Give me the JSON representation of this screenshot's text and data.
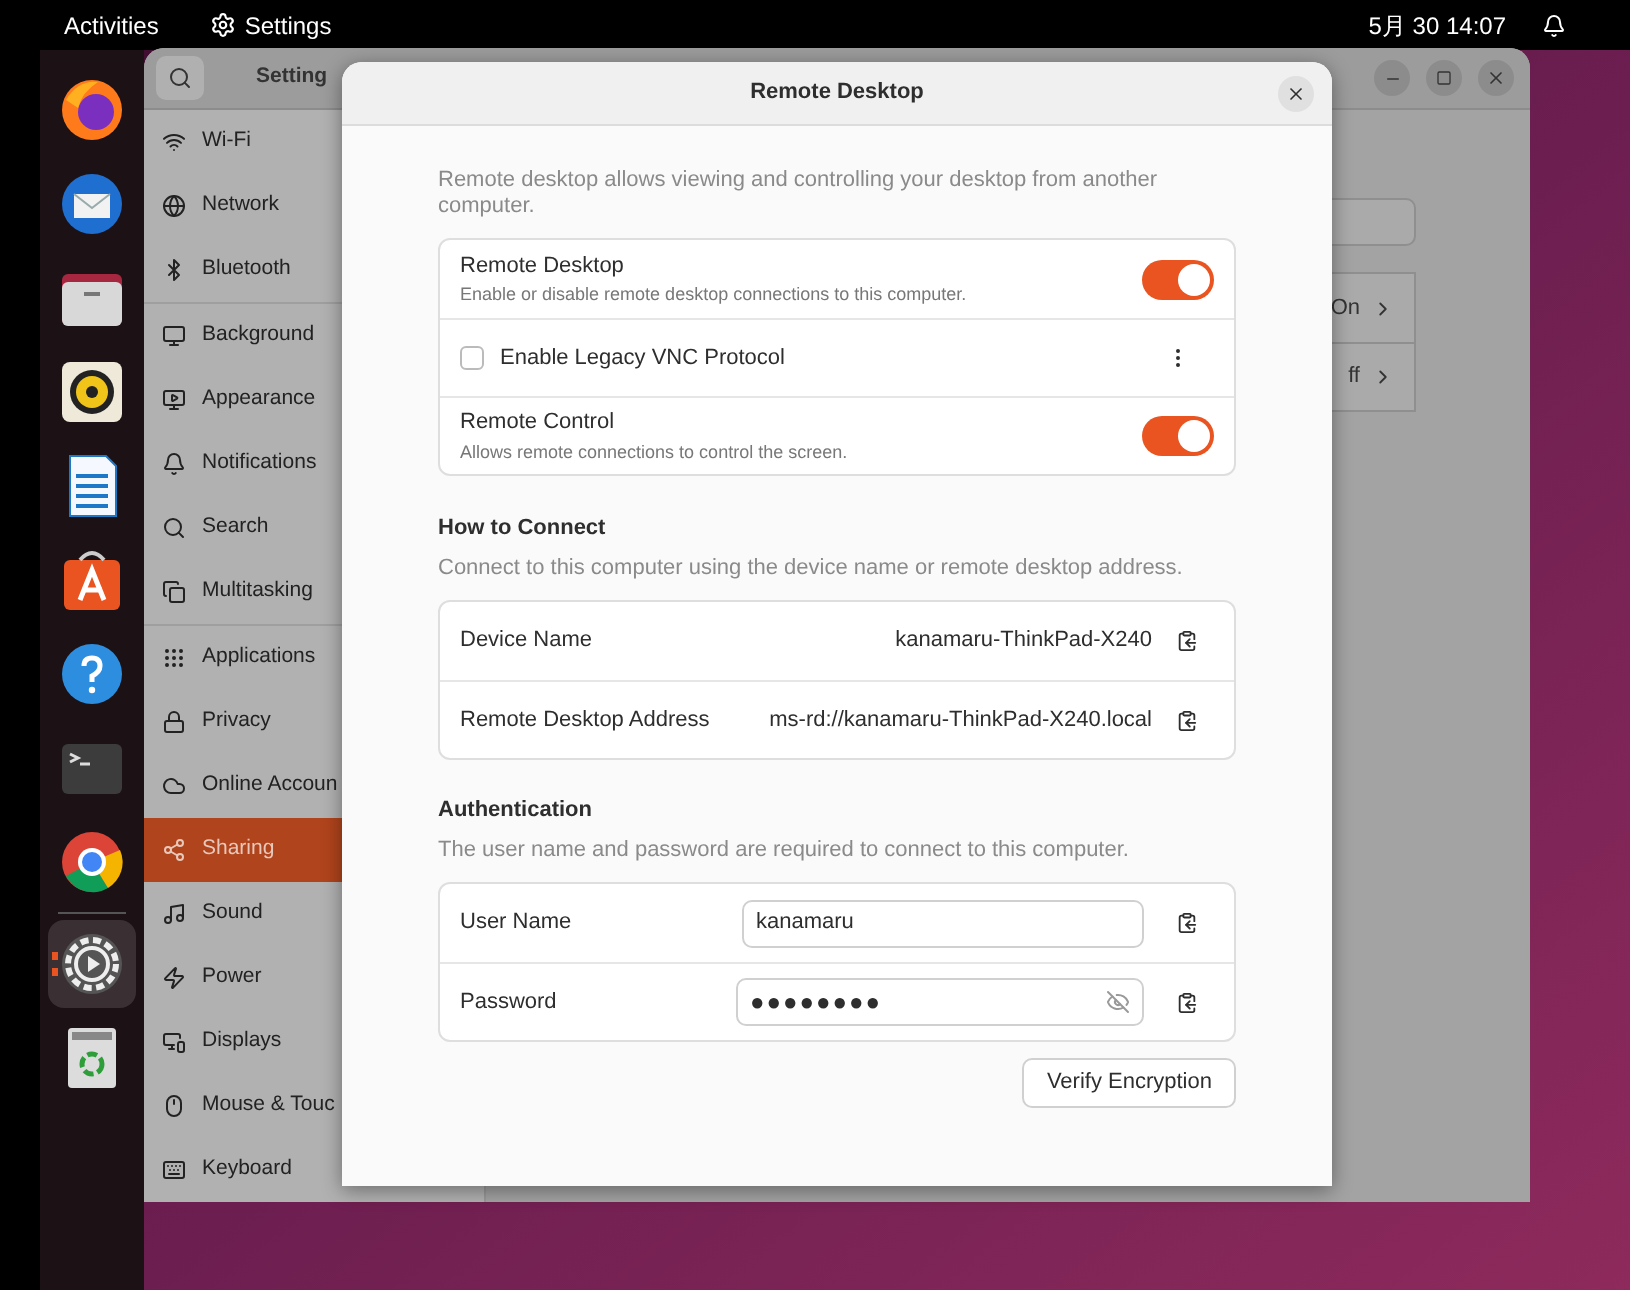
{
  "top_bar": {
    "activities": "Activities",
    "app_menu": "Settings",
    "clock": "5月 30 14:07"
  },
  "dock": {
    "items": [
      {
        "kind": "firefox",
        "running": false
      },
      {
        "kind": "mail",
        "running": false
      },
      {
        "kind": "files",
        "running": false
      },
      {
        "kind": "music",
        "running": false
      },
      {
        "kind": "writer",
        "running": false
      },
      {
        "kind": "store",
        "running": false
      },
      {
        "kind": "help",
        "running": false
      },
      {
        "kind": "terminal",
        "running": false
      },
      {
        "kind": "browser",
        "running": false
      },
      {
        "kind": "settings",
        "running": true
      },
      {
        "kind": "trash",
        "running": false
      }
    ]
  },
  "settings_window": {
    "title": "Setting",
    "sidebar": {
      "groups": [
        [
          {
            "label": "Wi-Fi",
            "selected": false
          },
          {
            "label": "Network",
            "selected": false
          },
          {
            "label": "Bluetooth",
            "selected": false
          }
        ],
        [
          {
            "label": "Background",
            "selected": false
          },
          {
            "label": "Appearance",
            "selected": false
          },
          {
            "label": "Notifications",
            "selected": false
          },
          {
            "label": "Search",
            "selected": false
          },
          {
            "label": "Multitasking",
            "selected": false
          }
        ],
        [
          {
            "label": "Applications",
            "selected": false
          },
          {
            "label": "Privacy",
            "selected": false
          },
          {
            "label": "Online Accoun",
            "selected": false
          },
          {
            "label": "Sharing",
            "selected": true
          },
          {
            "label": "Sound",
            "selected": false
          },
          {
            "label": "Power",
            "selected": false
          },
          {
            "label": "Displays",
            "selected": false
          },
          {
            "label": "Mouse & Touc",
            "selected": false
          },
          {
            "label": "Keyboard",
            "selected": false
          }
        ]
      ]
    },
    "panel_rows": [
      "On",
      "ff"
    ]
  },
  "dialog": {
    "title": "Remote Desktop",
    "description": "Remote desktop allows viewing and controlling your desktop from another computer.",
    "options": [
      {
        "kind": "toggle",
        "title": "Remote Desktop",
        "subtitle": "Enable or disable remote desktop connections to this computer.",
        "on": true
      },
      {
        "kind": "checkbox",
        "title": "Enable Legacy VNC Protocol",
        "checked": false
      },
      {
        "kind": "toggle",
        "title": "Remote Control",
        "subtitle": "Allows remote connections to control the screen.",
        "on": true
      }
    ],
    "how_to_connect": {
      "heading": "How to Connect",
      "description": "Connect to this computer using the device name or remote desktop address.",
      "rows": [
        {
          "label": "Device Name",
          "value": "kanamaru-ThinkPad-X240"
        },
        {
          "label": "Remote Desktop Address",
          "value": "ms-rd://kanamaru-ThinkPad-X240.local"
        }
      ]
    },
    "authentication": {
      "heading": "Authentication",
      "description": "The user name and password are required to connect to this computer.",
      "rows": [
        {
          "kind": "text",
          "label": "User Name",
          "value": "kanamaru"
        },
        {
          "kind": "password",
          "label": "Password",
          "value": "●●●●●●●●"
        }
      ]
    },
    "verify_button": "Verify Encryption"
  }
}
